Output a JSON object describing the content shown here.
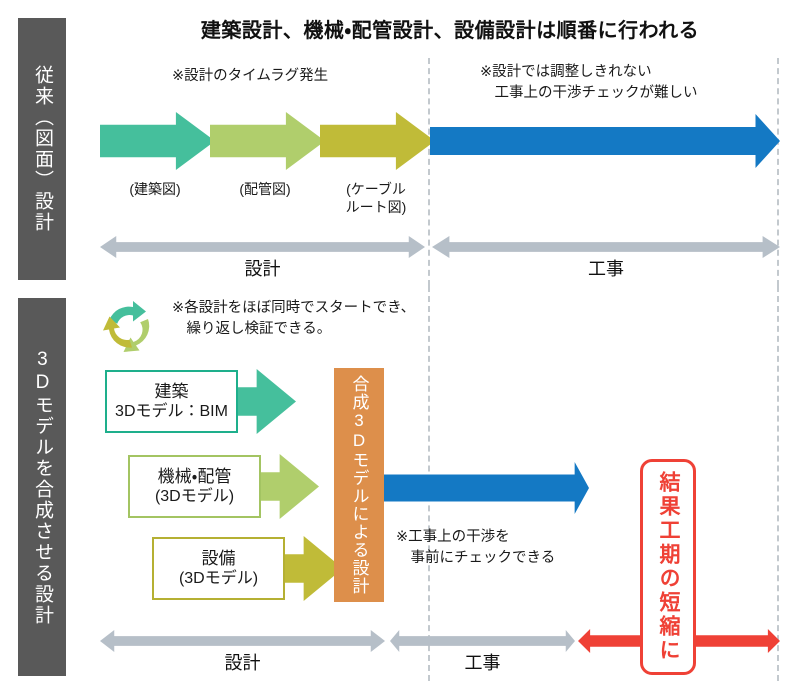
{
  "title": "建築設計、機械・配管設計、設備設計は順番に行われる",
  "colors": {
    "architecture": "#45bf9c",
    "piping": "#b0ce6c",
    "cable": "#c0bb38",
    "construction": "#1479c4",
    "synthesis": "#dd8f4b",
    "measure": "#b6bfc8",
    "highlight": "#ef4136",
    "side_label_bg": "#595959",
    "dashed_line": "#c3c9ce"
  },
  "sections": {
    "traditional": {
      "side_label": "従来（図面）設計",
      "note_timelag": "※設計のタイムラグ発生",
      "note_interference": "※設計では調整しきれない\n　工事上の干渉チェックが難しい",
      "arrows": [
        {
          "name": "architecture",
          "caption": "(建築図)",
          "color": "#45bf9c"
        },
        {
          "name": "piping",
          "caption": "(配管図)",
          "color": "#b0ce6c"
        },
        {
          "name": "cable",
          "caption": "(ケーブル\nルート図)",
          "color": "#c0bb38"
        },
        {
          "name": "construction",
          "caption": "",
          "color": "#1479c4"
        }
      ],
      "timeline": [
        {
          "label": "設計"
        },
        {
          "label": "工事"
        }
      ]
    },
    "bim": {
      "side_label": "3Dモデルを合成させる設計",
      "note_parallel": "※各設計をほぼ同時でスタートでき、\n　繰り返し検証できる。",
      "note_precheck": "※工事上の干渉を\n　事前にチェックできる",
      "recycle_icon": "recycle-arrows-icon",
      "model_boxes": [
        {
          "name": "architecture",
          "line1": "建築",
          "line2": "3Dモデル：BIM",
          "color": "#1eaf8c",
          "arrow_color": "#45bf9c"
        },
        {
          "name": "mechanical-piping",
          "line1": "機械・配管",
          "line2": "(3Dモデル)",
          "color": "#a3c462",
          "arrow_color": "#b0ce6c"
        },
        {
          "name": "equipment",
          "line1": "設備",
          "line2": "(3Dモデル)",
          "color": "#b5b033",
          "arrow_color": "#c0bb38"
        }
      ],
      "synthesis_column": "合成3Dモデルによる設計",
      "result_callout": "結果工期の短縮に",
      "timeline": [
        {
          "label": "設計"
        },
        {
          "label": "工事"
        },
        {
          "label": ""
        }
      ]
    }
  }
}
